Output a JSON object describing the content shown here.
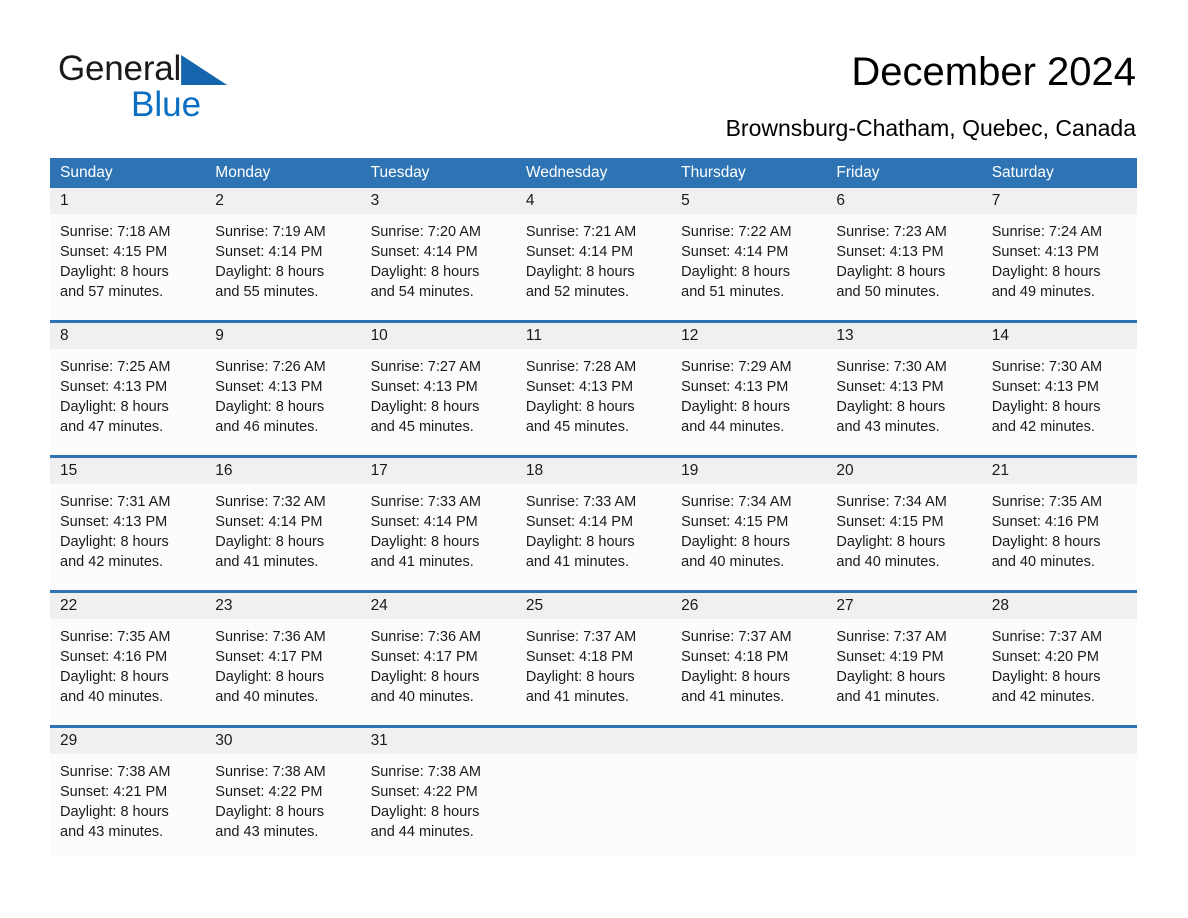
{
  "brand": {
    "name_part1": "General",
    "name_part2": "Blue",
    "flag_icon": "triangle-flag-icon",
    "accent_color": "#0a6fc2",
    "flag_color": "#1565ad"
  },
  "header": {
    "title": "December 2024",
    "location": "Brownsburg-Chatham, Quebec, Canada"
  },
  "calendar": {
    "header_color": "#2e74b5",
    "daynum_band_color": "#f0f0f0",
    "weekdays": [
      "Sunday",
      "Monday",
      "Tuesday",
      "Wednesday",
      "Thursday",
      "Friday",
      "Saturday"
    ],
    "weeks": [
      {
        "days": [
          {
            "num": "1",
            "sunrise": "Sunrise: 7:18 AM",
            "sunset": "Sunset: 4:15 PM",
            "daylight_1": "Daylight: 8 hours",
            "daylight_2": "and 57 minutes."
          },
          {
            "num": "2",
            "sunrise": "Sunrise: 7:19 AM",
            "sunset": "Sunset: 4:14 PM",
            "daylight_1": "Daylight: 8 hours",
            "daylight_2": "and 55 minutes."
          },
          {
            "num": "3",
            "sunrise": "Sunrise: 7:20 AM",
            "sunset": "Sunset: 4:14 PM",
            "daylight_1": "Daylight: 8 hours",
            "daylight_2": "and 54 minutes."
          },
          {
            "num": "4",
            "sunrise": "Sunrise: 7:21 AM",
            "sunset": "Sunset: 4:14 PM",
            "daylight_1": "Daylight: 8 hours",
            "daylight_2": "and 52 minutes."
          },
          {
            "num": "5",
            "sunrise": "Sunrise: 7:22 AM",
            "sunset": "Sunset: 4:14 PM",
            "daylight_1": "Daylight: 8 hours",
            "daylight_2": "and 51 minutes."
          },
          {
            "num": "6",
            "sunrise": "Sunrise: 7:23 AM",
            "sunset": "Sunset: 4:13 PM",
            "daylight_1": "Daylight: 8 hours",
            "daylight_2": "and 50 minutes."
          },
          {
            "num": "7",
            "sunrise": "Sunrise: 7:24 AM",
            "sunset": "Sunset: 4:13 PM",
            "daylight_1": "Daylight: 8 hours",
            "daylight_2": "and 49 minutes."
          }
        ]
      },
      {
        "days": [
          {
            "num": "8",
            "sunrise": "Sunrise: 7:25 AM",
            "sunset": "Sunset: 4:13 PM",
            "daylight_1": "Daylight: 8 hours",
            "daylight_2": "and 47 minutes."
          },
          {
            "num": "9",
            "sunrise": "Sunrise: 7:26 AM",
            "sunset": "Sunset: 4:13 PM",
            "daylight_1": "Daylight: 8 hours",
            "daylight_2": "and 46 minutes."
          },
          {
            "num": "10",
            "sunrise": "Sunrise: 7:27 AM",
            "sunset": "Sunset: 4:13 PM",
            "daylight_1": "Daylight: 8 hours",
            "daylight_2": "and 45 minutes."
          },
          {
            "num": "11",
            "sunrise": "Sunrise: 7:28 AM",
            "sunset": "Sunset: 4:13 PM",
            "daylight_1": "Daylight: 8 hours",
            "daylight_2": "and 45 minutes."
          },
          {
            "num": "12",
            "sunrise": "Sunrise: 7:29 AM",
            "sunset": "Sunset: 4:13 PM",
            "daylight_1": "Daylight: 8 hours",
            "daylight_2": "and 44 minutes."
          },
          {
            "num": "13",
            "sunrise": "Sunrise: 7:30 AM",
            "sunset": "Sunset: 4:13 PM",
            "daylight_1": "Daylight: 8 hours",
            "daylight_2": "and 43 minutes."
          },
          {
            "num": "14",
            "sunrise": "Sunrise: 7:30 AM",
            "sunset": "Sunset: 4:13 PM",
            "daylight_1": "Daylight: 8 hours",
            "daylight_2": "and 42 minutes."
          }
        ]
      },
      {
        "days": [
          {
            "num": "15",
            "sunrise": "Sunrise: 7:31 AM",
            "sunset": "Sunset: 4:13 PM",
            "daylight_1": "Daylight: 8 hours",
            "daylight_2": "and 42 minutes."
          },
          {
            "num": "16",
            "sunrise": "Sunrise: 7:32 AM",
            "sunset": "Sunset: 4:14 PM",
            "daylight_1": "Daylight: 8 hours",
            "daylight_2": "and 41 minutes."
          },
          {
            "num": "17",
            "sunrise": "Sunrise: 7:33 AM",
            "sunset": "Sunset: 4:14 PM",
            "daylight_1": "Daylight: 8 hours",
            "daylight_2": "and 41 minutes."
          },
          {
            "num": "18",
            "sunrise": "Sunrise: 7:33 AM",
            "sunset": "Sunset: 4:14 PM",
            "daylight_1": "Daylight: 8 hours",
            "daylight_2": "and 41 minutes."
          },
          {
            "num": "19",
            "sunrise": "Sunrise: 7:34 AM",
            "sunset": "Sunset: 4:15 PM",
            "daylight_1": "Daylight: 8 hours",
            "daylight_2": "and 40 minutes."
          },
          {
            "num": "20",
            "sunrise": "Sunrise: 7:34 AM",
            "sunset": "Sunset: 4:15 PM",
            "daylight_1": "Daylight: 8 hours",
            "daylight_2": "and 40 minutes."
          },
          {
            "num": "21",
            "sunrise": "Sunrise: 7:35 AM",
            "sunset": "Sunset: 4:16 PM",
            "daylight_1": "Daylight: 8 hours",
            "daylight_2": "and 40 minutes."
          }
        ]
      },
      {
        "days": [
          {
            "num": "22",
            "sunrise": "Sunrise: 7:35 AM",
            "sunset": "Sunset: 4:16 PM",
            "daylight_1": "Daylight: 8 hours",
            "daylight_2": "and 40 minutes."
          },
          {
            "num": "23",
            "sunrise": "Sunrise: 7:36 AM",
            "sunset": "Sunset: 4:17 PM",
            "daylight_1": "Daylight: 8 hours",
            "daylight_2": "and 40 minutes."
          },
          {
            "num": "24",
            "sunrise": "Sunrise: 7:36 AM",
            "sunset": "Sunset: 4:17 PM",
            "daylight_1": "Daylight: 8 hours",
            "daylight_2": "and 40 minutes."
          },
          {
            "num": "25",
            "sunrise": "Sunrise: 7:37 AM",
            "sunset": "Sunset: 4:18 PM",
            "daylight_1": "Daylight: 8 hours",
            "daylight_2": "and 41 minutes."
          },
          {
            "num": "26",
            "sunrise": "Sunrise: 7:37 AM",
            "sunset": "Sunset: 4:18 PM",
            "daylight_1": "Daylight: 8 hours",
            "daylight_2": "and 41 minutes."
          },
          {
            "num": "27",
            "sunrise": "Sunrise: 7:37 AM",
            "sunset": "Sunset: 4:19 PM",
            "daylight_1": "Daylight: 8 hours",
            "daylight_2": "and 41 minutes."
          },
          {
            "num": "28",
            "sunrise": "Sunrise: 7:37 AM",
            "sunset": "Sunset: 4:20 PM",
            "daylight_1": "Daylight: 8 hours",
            "daylight_2": "and 42 minutes."
          }
        ]
      },
      {
        "days": [
          {
            "num": "29",
            "sunrise": "Sunrise: 7:38 AM",
            "sunset": "Sunset: 4:21 PM",
            "daylight_1": "Daylight: 8 hours",
            "daylight_2": "and 43 minutes."
          },
          {
            "num": "30",
            "sunrise": "Sunrise: 7:38 AM",
            "sunset": "Sunset: 4:22 PM",
            "daylight_1": "Daylight: 8 hours",
            "daylight_2": "and 43 minutes."
          },
          {
            "num": "31",
            "sunrise": "Sunrise: 7:38 AM",
            "sunset": "Sunset: 4:22 PM",
            "daylight_1": "Daylight: 8 hours",
            "daylight_2": "and 44 minutes."
          },
          {
            "num": "",
            "sunrise": "",
            "sunset": "",
            "daylight_1": "",
            "daylight_2": ""
          },
          {
            "num": "",
            "sunrise": "",
            "sunset": "",
            "daylight_1": "",
            "daylight_2": ""
          },
          {
            "num": "",
            "sunrise": "",
            "sunset": "",
            "daylight_1": "",
            "daylight_2": ""
          },
          {
            "num": "",
            "sunrise": "",
            "sunset": "",
            "daylight_1": "",
            "daylight_2": ""
          }
        ]
      }
    ]
  }
}
